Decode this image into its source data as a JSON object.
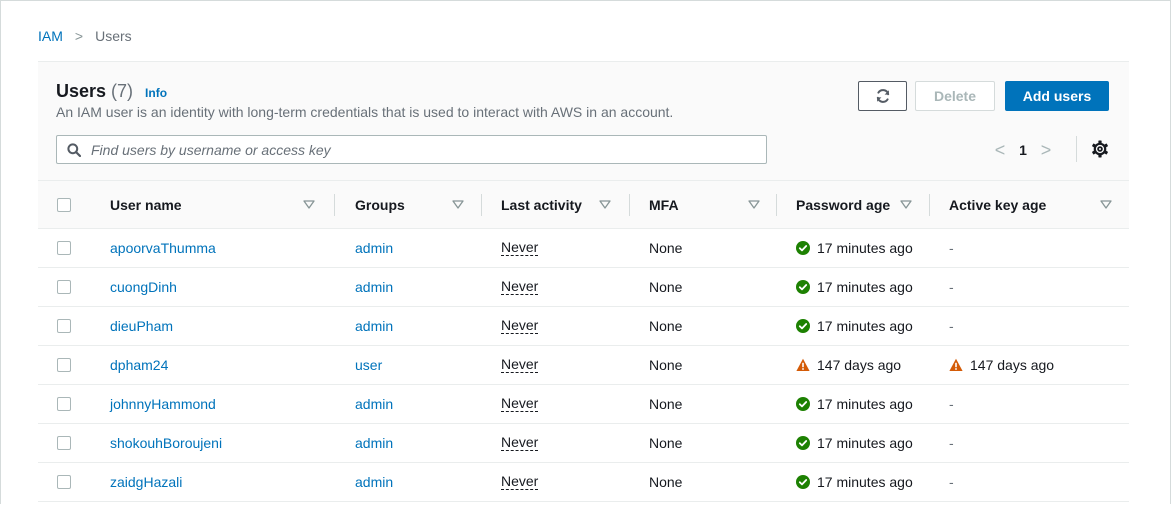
{
  "breadcrumb": {
    "root": "IAM",
    "separator": ">",
    "current": "Users"
  },
  "panel": {
    "title": "Users",
    "count": "(7)",
    "info_label": "Info",
    "description": "An IAM user is an identity with long-term credentials that is used to interact with AWS in an account."
  },
  "buttons": {
    "refresh_icon": "refresh-icon",
    "delete": "Delete",
    "add": "Add users"
  },
  "search": {
    "placeholder": "Find users by username or access key",
    "value": ""
  },
  "pagination": {
    "prev": "<",
    "page": "1",
    "next": ">"
  },
  "columns": {
    "user_name": "User name",
    "groups": "Groups",
    "last_activity": "Last activity",
    "mfa": "MFA",
    "password_age": "Password age",
    "active_key_age": "Active key age"
  },
  "colors": {
    "link": "#0073bb",
    "primary": "#0073bb",
    "success": "#1d8102",
    "warning": "#d45b07"
  },
  "rows": [
    {
      "user": "apoorvaThumma",
      "group": "admin",
      "last_activity": "Never",
      "mfa": "None",
      "password_age": "17 minutes ago",
      "password_status": "success",
      "key_age": "-",
      "key_status": "none"
    },
    {
      "user": "cuongDinh",
      "group": "admin",
      "last_activity": "Never",
      "mfa": "None",
      "password_age": "17 minutes ago",
      "password_status": "success",
      "key_age": "-",
      "key_status": "none"
    },
    {
      "user": "dieuPham",
      "group": "admin",
      "last_activity": "Never",
      "mfa": "None",
      "password_age": "17 minutes ago",
      "password_status": "success",
      "key_age": "-",
      "key_status": "none"
    },
    {
      "user": "dpham24",
      "group": "user",
      "last_activity": "Never",
      "mfa": "None",
      "password_age": "147 days ago",
      "password_status": "warning",
      "key_age": "147 days ago",
      "key_status": "warning"
    },
    {
      "user": "johnnyHammond",
      "group": "admin",
      "last_activity": "Never",
      "mfa": "None",
      "password_age": "17 minutes ago",
      "password_status": "success",
      "key_age": "-",
      "key_status": "none"
    },
    {
      "user": "shokouhBoroujeni",
      "group": "admin",
      "last_activity": "Never",
      "mfa": "None",
      "password_age": "17 minutes ago",
      "password_status": "success",
      "key_age": "-",
      "key_status": "none"
    },
    {
      "user": "zaidgHazali",
      "group": "admin",
      "last_activity": "Never",
      "mfa": "None",
      "password_age": "17 minutes ago",
      "password_status": "success",
      "key_age": "-",
      "key_status": "none"
    }
  ]
}
